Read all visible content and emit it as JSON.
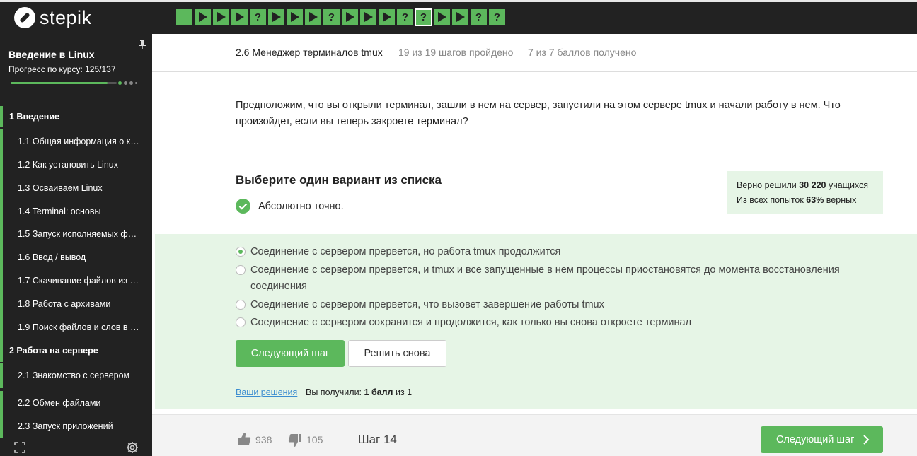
{
  "brand": {
    "name": "stepik",
    "accent": "#5cb85c"
  },
  "top_steps": [
    "play",
    "play",
    "play",
    "question",
    "play",
    "play",
    "play",
    "question",
    "play",
    "play",
    "play",
    "question",
    "question",
    "play",
    "play",
    "question",
    "question"
  ],
  "sidebar": {
    "course_title": "Введение в Linux",
    "progress_text": "Прогресс по курсу:  125/137",
    "progress": {
      "done": 125,
      "total": 137
    },
    "items": [
      {
        "kind": "section",
        "label": "1  Введение"
      },
      {
        "kind": "lesson",
        "label": "1.1  Общая информация о курсе"
      },
      {
        "kind": "lesson",
        "label": "1.2  Как установить Linux"
      },
      {
        "kind": "lesson",
        "label": "1.3  Осваиваем Linux"
      },
      {
        "kind": "lesson",
        "label": "1.4  Terminal: основы"
      },
      {
        "kind": "lesson",
        "label": "1.5  Запуск исполняемых файлов"
      },
      {
        "kind": "lesson",
        "label": "1.6  Ввод / вывод"
      },
      {
        "kind": "lesson",
        "label": "1.7  Скачивание файлов из интернета"
      },
      {
        "kind": "lesson",
        "label": "1.8  Работа с архивами"
      },
      {
        "kind": "lesson",
        "label": "1.9  Поиск файлов и слов в файлах"
      },
      {
        "kind": "section",
        "label": "2  Работа на сервере"
      },
      {
        "kind": "lesson",
        "label": "2.1  Знакомство с сервером"
      },
      {
        "kind": "lesson",
        "label": "2.2  Обмен файлами"
      },
      {
        "kind": "lesson",
        "label": "2.3  Запуск приложений"
      }
    ]
  },
  "lesson": {
    "title": "2.6 Менеджер терминалов tmux",
    "steps_done": "19 из 19 шагов пройдено",
    "points": "7 из 7 баллов  получено"
  },
  "question": "Предположим, что вы открыли терминал, зашли в нем на сервер, запустили на этом сервере tmux и начали работу в нем. Что произойдет, если вы теперь закроете терминал?",
  "quiz": {
    "title": "Выберите один вариант из списка",
    "feedback": "Абсолютно точно.",
    "stats": {
      "solved_prefix": "Верно решили ",
      "solved_count": "30 220",
      "solved_suffix": " учащихся",
      "attempts_prefix": "Из всех попыток ",
      "attempts_percent": "63%",
      "attempts_suffix": " верных"
    },
    "options": [
      {
        "label": "Соединение с сервером прервется, но работа tmux продолжится",
        "checked": true
      },
      {
        "label": "Соединение с сервером прервется, и tmux и все запущенные в нем процессы приостановятся до момента восстановления соединения",
        "checked": false
      },
      {
        "label": "Соединение с сервером прервется, что вызовет завершение работы tmux",
        "checked": false
      },
      {
        "label": "Соединение с сервером сохранится и продолжится, как только вы снова откроете терминал",
        "checked": false
      }
    ],
    "next_button": "Следующий шаг",
    "retry_button": "Решить снова",
    "solutions_link": "Ваши решения",
    "score_prefix": "Вы получили: ",
    "score_value": "1 балл",
    "score_suffix": " из 1"
  },
  "footer": {
    "likes": "938",
    "dislikes": "105",
    "step_label": "Шаг 14",
    "next_button": "Следующий шаг"
  }
}
